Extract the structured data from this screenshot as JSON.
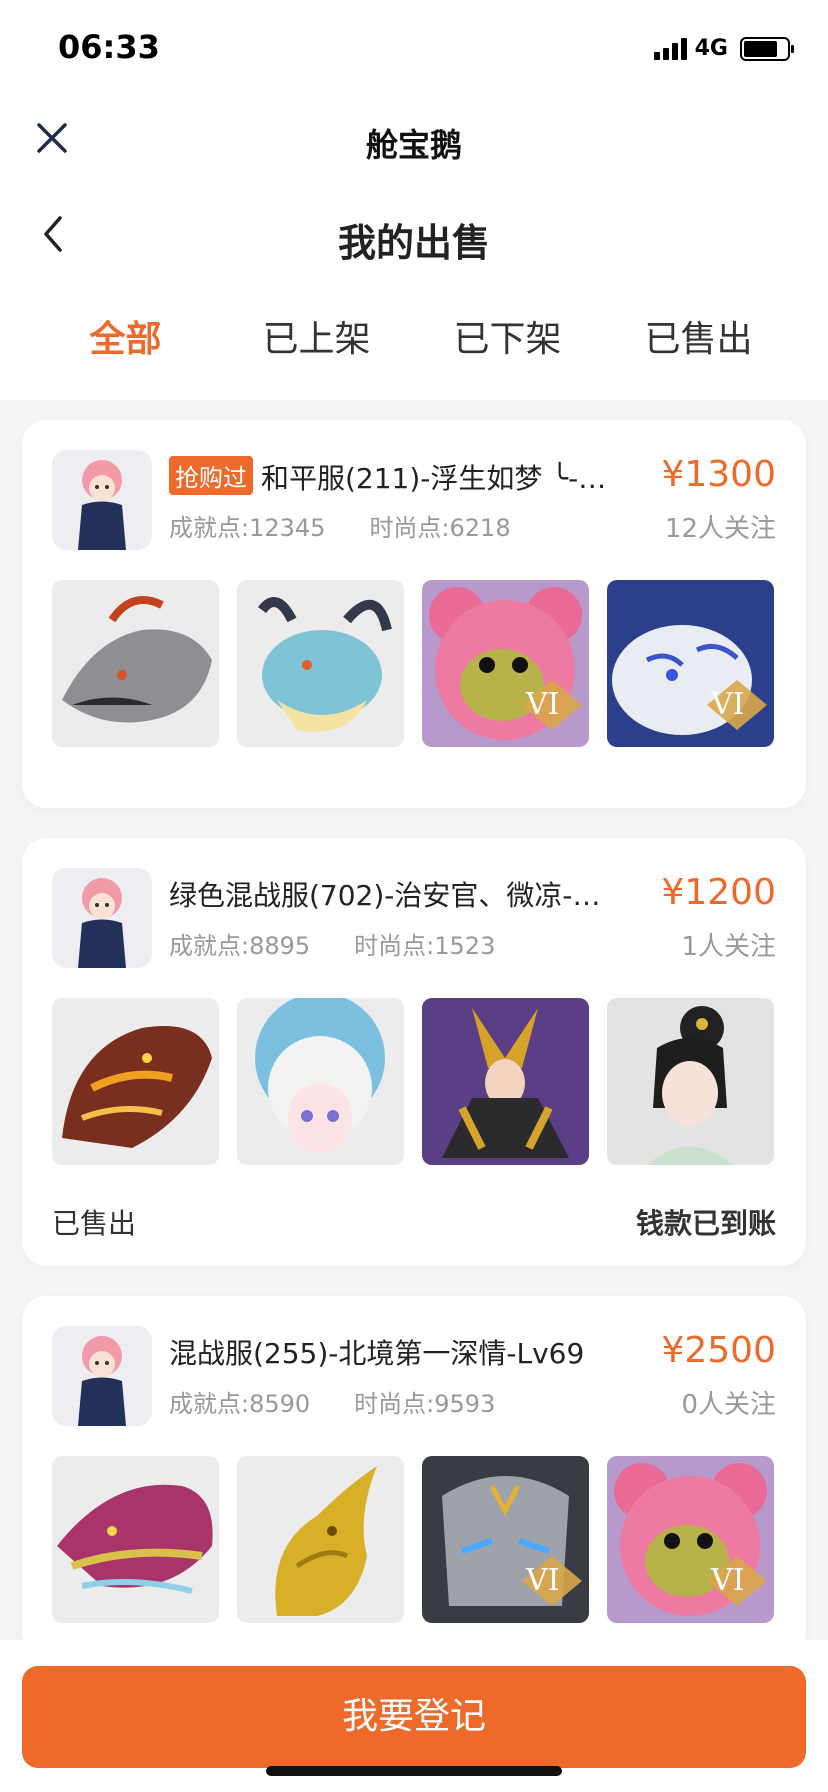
{
  "status_bar": {
    "time": "06:33",
    "network": "4G"
  },
  "mini_program": {
    "title": "舱宝鹅"
  },
  "page": {
    "title": "我的出售"
  },
  "tabs": [
    {
      "label": "全部",
      "active": true
    },
    {
      "label": "已上架",
      "active": false
    },
    {
      "label": "已下架",
      "active": false
    },
    {
      "label": "已售出",
      "active": false
    }
  ],
  "listings": [
    {
      "tag": "抢购过",
      "title": "和平服(211)-浮生如梦 ╰-…",
      "price": "¥1300",
      "achievement": "成就点:12345",
      "fashion": "时尚点:6218",
      "followers": "12人关注",
      "thumbnails": [
        "dark-dragon-icon",
        "ice-dragon-icon",
        "pink-bear-vi-icon",
        "white-tiger-vi-icon"
      ]
    },
    {
      "title": "绿色混战服(702)-治安官、微凉-…",
      "price": "¥1200",
      "achievement": "成就点:8895",
      "fashion": "时尚点:1523",
      "followers": "1人关注",
      "status": "已售出",
      "payment": "钱款已到账",
      "thumbnails": [
        "fire-dragon-icon",
        "cloud-girl-icon",
        "golden-warrior-icon",
        "classic-lady-icon"
      ]
    },
    {
      "title": "混战服(255)-北境第一深情-Lv69",
      "price": "¥2500",
      "achievement": "成就点:8590",
      "fashion": "时尚点:9593",
      "followers": "0人关注",
      "thumbnails": [
        "rainbow-dragon-icon",
        "gold-dragon-icon",
        "stone-armor-vi-icon",
        "pink-bear-vi-icon"
      ]
    }
  ],
  "footer": {
    "primary_action": "我要登记"
  },
  "colors": {
    "accent": "#ee6a2b",
    "background": "#f5f5f7",
    "muted_text": "#999999"
  }
}
